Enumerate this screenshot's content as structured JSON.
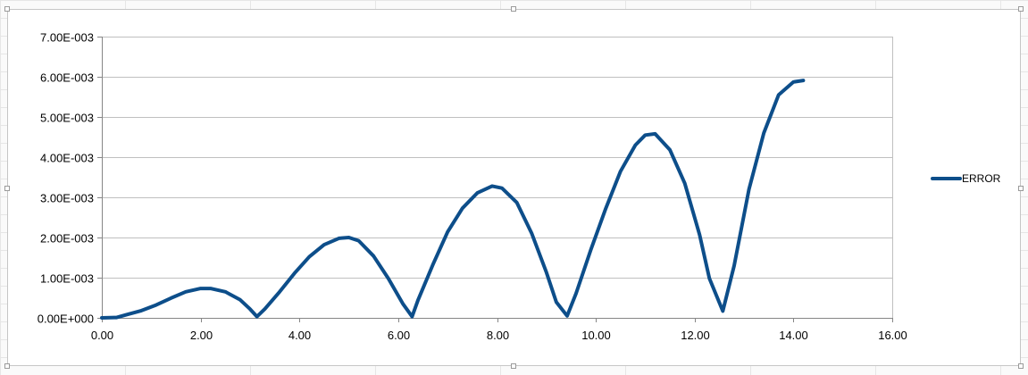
{
  "chart_data": {
    "type": "line",
    "title": "",
    "xlabel": "",
    "ylabel": "",
    "xlim": [
      0,
      16
    ],
    "ylim": [
      0,
      0.007
    ],
    "x_ticks": [
      0,
      2,
      4,
      6,
      8,
      10,
      12,
      14,
      16
    ],
    "x_tick_labels": [
      "0.00",
      "2.00",
      "4.00",
      "6.00",
      "8.00",
      "10.00",
      "12.00",
      "14.00",
      "16.00"
    ],
    "y_ticks": [
      0,
      0.001,
      0.002,
      0.003,
      0.004,
      0.005,
      0.006,
      0.007
    ],
    "y_tick_labels": [
      "0.00E+000",
      "1.00E-003",
      "2.00E-003",
      "3.00E-003",
      "4.00E-003",
      "5.00E-003",
      "6.00E-003",
      "7.00E-003"
    ],
    "grid": true,
    "legend_position": "right",
    "series": [
      {
        "name": "ERROR",
        "color": "#0d4e8a",
        "x": [
          0,
          0.3,
          0.5,
          0.8,
          1.1,
          1.4,
          1.7,
          2.0,
          2.2,
          2.5,
          2.8,
          3.0,
          3.14,
          3.3,
          3.6,
          3.9,
          4.2,
          4.5,
          4.8,
          5.0,
          5.2,
          5.5,
          5.8,
          6.1,
          6.28,
          6.4,
          6.7,
          7.0,
          7.3,
          7.6,
          7.9,
          8.1,
          8.4,
          8.7,
          9.0,
          9.2,
          9.42,
          9.6,
          9.9,
          10.2,
          10.5,
          10.8,
          11.0,
          11.2,
          11.5,
          11.8,
          12.1,
          12.3,
          12.57,
          12.8,
          13.1,
          13.4,
          13.7,
          14.0,
          14.2
        ],
        "y": [
          0.0,
          1e-05,
          8e-05,
          0.00018,
          0.00032,
          0.00049,
          0.00065,
          0.00073,
          0.00073,
          0.00065,
          0.00045,
          0.00022,
          3e-05,
          0.00022,
          0.00065,
          0.00111,
          0.00152,
          0.00182,
          0.00198,
          0.002,
          0.00192,
          0.00154,
          0.00098,
          0.00034,
          3e-05,
          0.00044,
          0.00132,
          0.00214,
          0.00273,
          0.00311,
          0.00328,
          0.00323,
          0.00287,
          0.00211,
          0.00113,
          0.00039,
          5e-05,
          0.00061,
          0.0017,
          0.00272,
          0.00365,
          0.0043,
          0.00455,
          0.00458,
          0.00418,
          0.00335,
          0.00207,
          0.00098,
          0.00017,
          0.0013,
          0.0032,
          0.0046,
          0.00555,
          0.00587,
          0.00591
        ]
      }
    ]
  }
}
